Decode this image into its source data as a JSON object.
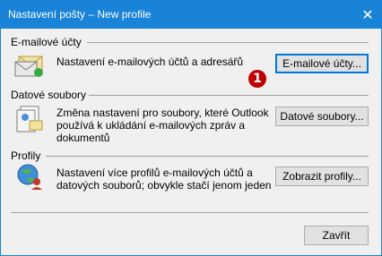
{
  "window": {
    "title": "Nastavení pošty – New profile",
    "close_glyph": "✕"
  },
  "sections": [
    {
      "title": "E-mailové účty",
      "description": "Nastavení e-mailových účtů a adresářů",
      "button": "E-mailové účty...",
      "icon": "email-accounts-icon"
    },
    {
      "title": "Datové soubory",
      "description": "Změna nastavení pro soubory, které Outlook používá k ukládání e-mailových zpráv a dokumentů",
      "button": "Datové soubory...",
      "icon": "data-files-icon"
    },
    {
      "title": "Profily",
      "description": "Nastavení více profilů e-mailových účtů a datových souborů; obvykle stačí jenom jeden",
      "button": "Zobrazit profily...",
      "icon": "profiles-icon"
    }
  ],
  "annotation_badge": "1",
  "footer": {
    "close_button": "Zavřít"
  },
  "colors": {
    "titlebar": "#1883d7",
    "badge": "#c00000"
  }
}
